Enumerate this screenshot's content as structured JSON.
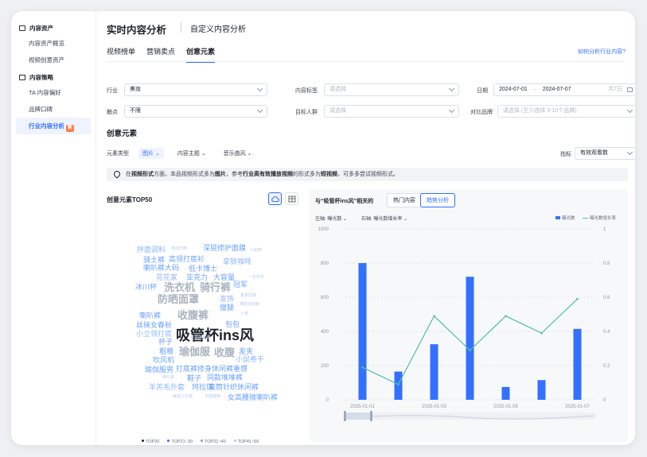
{
  "sidebar": {
    "groups": [
      {
        "label": "内容资产",
        "items": [
          "内容资产概览",
          "视频创意资产"
        ]
      },
      {
        "label": "内容策略",
        "items": [
          "TA 内容偏好",
          "品牌口碑",
          "行业内容分析"
        ]
      }
    ]
  },
  "header": {
    "title": "实时内容分析",
    "alt_title": "自定义内容分析"
  },
  "tabs": [
    "视频榜单",
    "营销卖点",
    "创意元素"
  ],
  "help_link": "如何分析行业内容?",
  "filters": {
    "industry": {
      "label": "行业",
      "value": "美妆"
    },
    "content_tag": {
      "label": "内容标签",
      "placeholder": "请选择"
    },
    "date": {
      "label": "日期",
      "start": "2024-07-01",
      "end": "2024-07-07",
      "span": "共7日"
    },
    "touchpoint": {
      "label": "触点",
      "value": "不限"
    },
    "target_audience": {
      "label": "目标人群",
      "placeholder": "请选择"
    },
    "compare_brand": {
      "label": "对比品牌",
      "placeholder": "请选择 (至少选择 3-10个品牌)"
    }
  },
  "section_title": "创意元素",
  "element_type": {
    "label": "元素类型",
    "options": [
      "图片",
      "内容主题",
      "音乐曲风"
    ],
    "selected": "图片"
  },
  "metric": {
    "label": "指标",
    "value": "有效观看数"
  },
  "notice": {
    "pre": "在",
    "b1": "视频形式",
    "mid1": "方面，本品视频形式多为",
    "b2": "图片",
    "mid2": "，参考",
    "b3": "行业高有效播放视频",
    "mid3": "的形式多为",
    "b4": "短视频",
    "post": "，可多多尝试视频形式。"
  },
  "cloud_panel": {
    "title": "创意元素TOP50",
    "words": [
      {
        "text": "拌面调料",
        "tier": 3
      },
      {
        "text": "电动牙刷",
        "tier": 4
      },
      {
        "text": "深层修护面膜",
        "tier": 3
      },
      {
        "text": "小狗窝",
        "tier": 4
      },
      {
        "text": "骑士裤",
        "tier": 3
      },
      {
        "text": "高领打底衫",
        "tier": 3
      },
      {
        "text": "拿铁咖啡",
        "tier": 3
      },
      {
        "text": "喇叭裤大码",
        "tier": 3
      },
      {
        "text": "低卡博士",
        "tier": 3
      },
      {
        "text": "花花家",
        "tier": 3
      },
      {
        "text": "亚克力",
        "tier": 3
      },
      {
        "text": "大容量",
        "tier": 3
      },
      {
        "text": "一包可乐",
        "tier": 4
      },
      {
        "text": "冰川杯",
        "tier": 3
      },
      {
        "text": "洗衣机",
        "tier": 2
      },
      {
        "text": "骑行裤",
        "tier": 2
      },
      {
        "text": "冠军",
        "tier": 3
      },
      {
        "text": "防晒面罩",
        "tier": 2
      },
      {
        "text": "发饰",
        "tier": 3
      },
      {
        "text": "夏季短袖",
        "tier": 4
      },
      {
        "text": "瘦腿",
        "tier": 3
      },
      {
        "text": "薄款运动裤",
        "tier": 4
      },
      {
        "text": "喇叭裤",
        "tier": 3
      },
      {
        "text": "收腹裤",
        "tier": 2
      },
      {
        "text": "人像",
        "tier": 4
      },
      {
        "text": "丝袜女春秋",
        "tier": 3
      },
      {
        "text": "包包",
        "tier": 3
      },
      {
        "text": "小立领打底",
        "tier": 3
      },
      {
        "text": "吸管杯ins风",
        "tier": 1
      },
      {
        "text": "杯子",
        "tier": 3
      },
      {
        "text": "夏季连衣裙",
        "tier": 4
      },
      {
        "text": "粗粮",
        "tier": 3
      },
      {
        "text": "瑜伽服",
        "tier": 2
      },
      {
        "text": "收腹",
        "tier": 2
      },
      {
        "text": "发夹",
        "tier": 3
      },
      {
        "text": "吹风机",
        "tier": 3
      },
      {
        "text": "小鼠卷干",
        "tier": 3
      },
      {
        "text": "瑜伽服男",
        "tier": 3
      },
      {
        "text": "打底裤修身休闲裤重感",
        "tier": 3
      },
      {
        "text": "喇叭裤",
        "tier": 4
      },
      {
        "text": "鞋子",
        "tier": 3
      },
      {
        "text": "同款堆堆裤",
        "tier": 3
      },
      {
        "text": "羊羔毛外套",
        "tier": 3
      },
      {
        "text": "珂拉琪",
        "tier": 3
      },
      {
        "text": "直筒针织休闲裤",
        "tier": 3
      },
      {
        "text": "美妆工作室",
        "tier": 4
      },
      {
        "text": "平面模特",
        "tier": 4
      },
      {
        "text": "女高腰微喇叭裤",
        "tier": 3
      }
    ],
    "legend": [
      "TOP20",
      "TOP21~30",
      "TOP31~40",
      "TOP41~50"
    ]
  },
  "trend_panel": {
    "title": "与“吸管杯ins风”相关的",
    "tabs": [
      "热门内容",
      "趋势分析"
    ],
    "active_tab": "趋势分析",
    "left_axis_label": "左轴: 曝光数",
    "right_axis_label": "右轴: 曝光数增长率",
    "legend": [
      "曝光数",
      "曝光数增长率"
    ]
  },
  "colors": {
    "accent": "#3370ff",
    "bar": "#3370ff",
    "line": "#4fc3a1"
  },
  "chart_data": {
    "type": "bar",
    "categories": [
      "2025-01-01",
      "2025-01-02",
      "2025-01-03",
      "2025-01-04",
      "2025-01-05",
      "2025-01-06",
      "2025-01-07"
    ],
    "x_tick_labels": [
      "2025-01-01",
      "2025-01-03",
      "2025-01-05",
      "2025-01-07"
    ],
    "series": [
      {
        "name": "曝光数",
        "type": "bar",
        "axis": "left",
        "values": [
          800,
          165,
          325,
          720,
          75,
          115,
          415
        ]
      },
      {
        "name": "曝光数增长率",
        "type": "line",
        "axis": "right",
        "values": [
          0.19,
          0.09,
          0.49,
          0.29,
          0.49,
          0.39,
          0.59
        ]
      }
    ],
    "ylim_left": [
      0,
      1000
    ],
    "ylim_right": [
      0,
      1
    ],
    "yticks_left": [
      0,
      200,
      400,
      600,
      800,
      1000
    ],
    "yticks_right": [
      0,
      0.2,
      0.4,
      0.6,
      0.8,
      1
    ],
    "grid": true,
    "legend_position": "top-right"
  }
}
